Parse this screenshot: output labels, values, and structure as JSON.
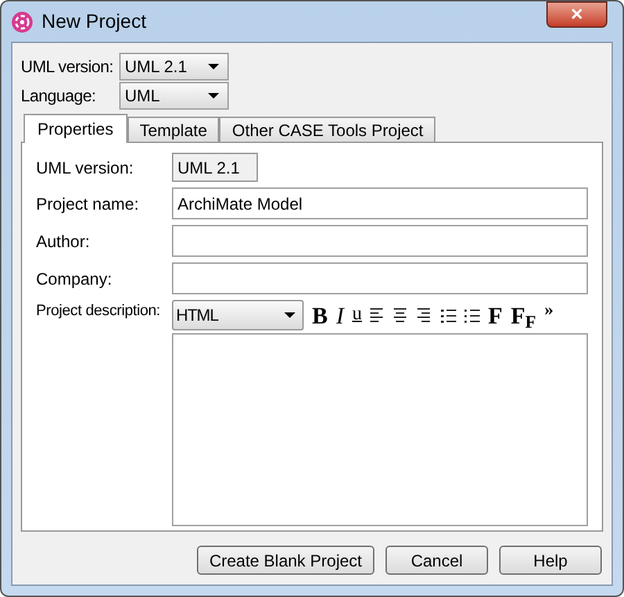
{
  "window": {
    "title": "New Project",
    "close": "×"
  },
  "top_fields": [
    {
      "label": "UML version:",
      "value": "UML 2.1"
    },
    {
      "label": "Language:",
      "value": "UML"
    }
  ],
  "tabs": [
    {
      "label": "Properties",
      "selected": true
    },
    {
      "label": "Template",
      "selected": false
    },
    {
      "label": "Other CASE Tools Project",
      "selected": false
    }
  ],
  "properties": {
    "uml_version": {
      "label": "UML version:",
      "value": "UML 2.1"
    },
    "fields": [
      {
        "label": "Project name:",
        "value": "ArchiMate Model"
      },
      {
        "label": "Author:"
      },
      {
        "label": "Company:"
      }
    ],
    "description": {
      "label": "Project description:",
      "format": "HTML",
      "toolbar": [
        {
          "kind": "bold",
          "label": "B"
        },
        {
          "kind": "italic",
          "label": "I"
        },
        {
          "kind": "underline",
          "label": "u"
        },
        {
          "kind": "left"
        },
        {
          "kind": "center"
        },
        {
          "kind": "right"
        },
        {
          "kind": "numbered"
        },
        {
          "kind": "bulleted"
        },
        {
          "kind": "bold",
          "label": "F"
        },
        {
          "kind": "bold",
          "label": "F$_{F}$"
        },
        {
          "kind": "more",
          "label": "»"
        }
      ]
    }
  },
  "buttons": [
    "Create Blank Project",
    "Cancel",
    "Help"
  ]
}
